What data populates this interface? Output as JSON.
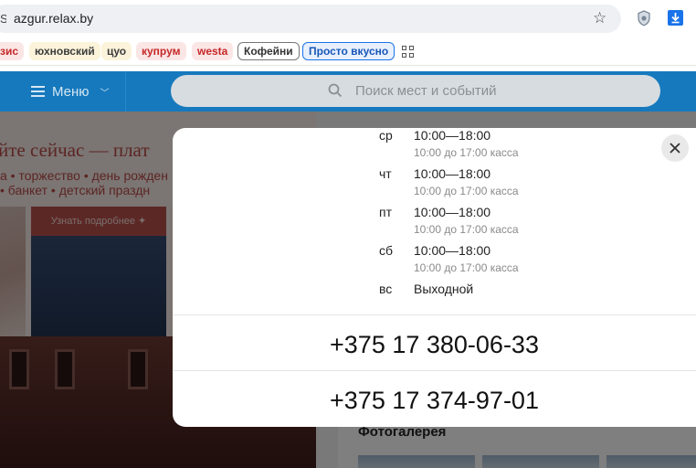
{
  "browser": {
    "site_glyph": "S",
    "url": "azgur.relax.by",
    "bookmarks": [
      {
        "label": "зис",
        "style": "pink"
      },
      {
        "label": "юхновский",
        "style": "yellow"
      },
      {
        "label": "цуо",
        "style": "yellow"
      },
      {
        "label": "купрум",
        "style": "pink"
      },
      {
        "label": "westa",
        "style": "pink"
      },
      {
        "label": "Кофейни",
        "style": "outline"
      },
      {
        "label": "Просто вкусно",
        "style": "blue"
      }
    ],
    "icons": [
      "star-icon",
      "shield-icon",
      "download-icon",
      "apps-icon"
    ]
  },
  "header": {
    "menu_label": "Меню",
    "search_placeholder": "Поиск мест и событий",
    "accent_color": "#1679bd"
  },
  "banner": {
    "headline": "йте сейчас — плат",
    "line1": "а • торжество • день рожден",
    "line2": "• банкет • детский праздн",
    "learn_more": "Узнать подробнее ✦"
  },
  "page": {
    "gallery_title": "Фотогалерея"
  },
  "modal": {
    "schedule": [
      {
        "day": "ср",
        "hours": "10:00—18:00",
        "note": "10:00 до 17:00 касса"
      },
      {
        "day": "чт",
        "hours": "10:00—18:00",
        "note": "10:00 до 17:00 касса"
      },
      {
        "day": "пт",
        "hours": "10:00—18:00",
        "note": "10:00 до 17:00 касса"
      },
      {
        "day": "сб",
        "hours": "10:00—18:00",
        "note": "10:00 до 17:00 касса"
      },
      {
        "day": "вс",
        "hours": "Выходной",
        "note": ""
      }
    ],
    "phones": [
      "+375 17 380-06-33",
      "+375 17 374-97-01"
    ]
  }
}
